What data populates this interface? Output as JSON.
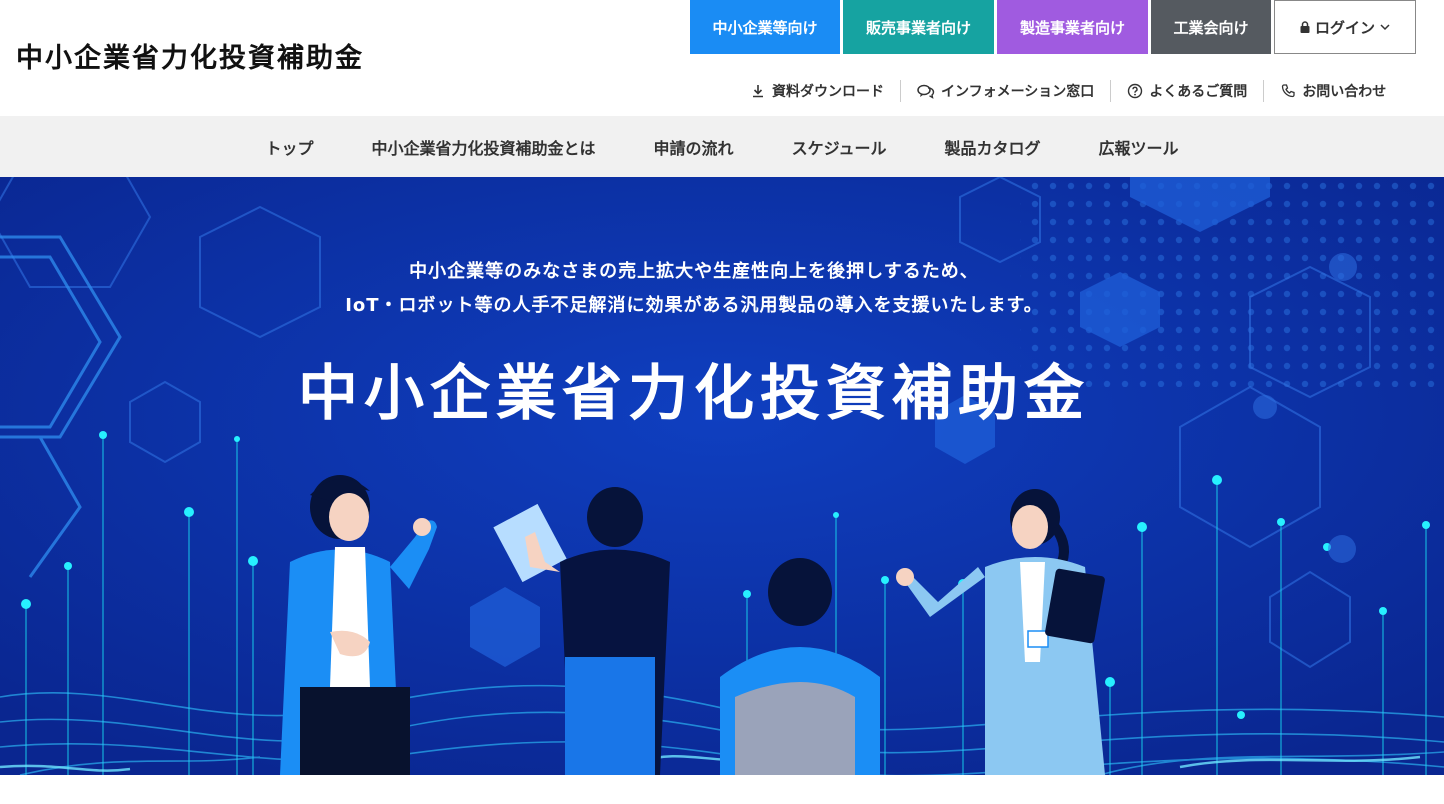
{
  "header": {
    "site_title": "中小企業省力化投資補助金",
    "audience_tabs": [
      {
        "label": "中小企業等向け",
        "color": "#1a8cf4"
      },
      {
        "label": "販売事業者向け",
        "color": "#16a3a1"
      },
      {
        "label": "製造事業者向け",
        "color": "#a05be0"
      },
      {
        "label": "工業会向け",
        "color": "#555a60"
      }
    ],
    "login_label": "ログイン",
    "utility_links": [
      {
        "label": "資料ダウンロード",
        "icon": "download-icon"
      },
      {
        "label": "インフォメーション窓口",
        "icon": "chat-icon"
      },
      {
        "label": "よくあるご質問",
        "icon": "question-icon"
      },
      {
        "label": "お問い合わせ",
        "icon": "phone-icon"
      }
    ]
  },
  "nav": {
    "items": [
      "トップ",
      "中小企業省力化投資補助金とは",
      "申請の流れ",
      "スケジュール",
      "製品カタログ",
      "広報ツール"
    ]
  },
  "hero": {
    "lead_line1": "中小企業等のみなさまの売上拡大や生産性向上を後押しするため、",
    "lead_line2": "IoT・ロボット等の人手不足解消に効果がある汎用製品の導入を支援いたします。",
    "title": "中小企業省力化投資補助金",
    "colors": {
      "background": "#0a2a9c",
      "accent": "#19e0f0"
    }
  }
}
